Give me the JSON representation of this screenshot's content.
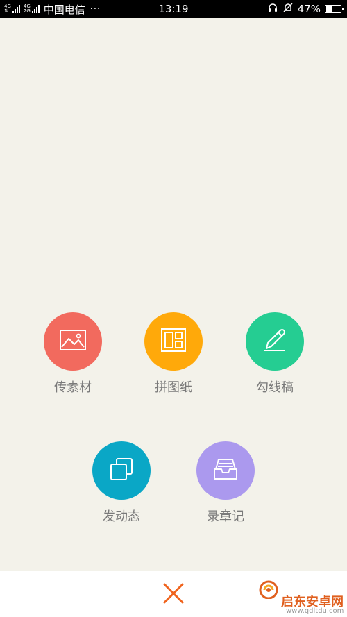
{
  "status_bar": {
    "network_1": "4G",
    "network_2": "4G",
    "network_2_sub": "2G",
    "carrier": "中国电信",
    "overflow": "···",
    "time": "13:19",
    "battery_text": "47%",
    "battery_level": 0.47,
    "icons": [
      "headset-icon",
      "alarm-off-icon",
      "battery-icon"
    ]
  },
  "actions": [
    {
      "label": "传素材",
      "color": "#f26a5e",
      "icon": "image-icon"
    },
    {
      "label": "拼图纸",
      "color": "#ffa90a",
      "icon": "layout-grid-icon"
    },
    {
      "label": "勾线稿",
      "color": "#25cd92",
      "icon": "pen-icon"
    },
    {
      "label": "发动态",
      "color": "#0aa7c6",
      "icon": "layers-icon"
    },
    {
      "label": "录章记",
      "color": "#ab99ee",
      "icon": "inbox-tray-icon"
    }
  ],
  "bottom_bar": {
    "close_icon": "close-icon",
    "close_color": "#f0641e"
  },
  "watermark": {
    "title": "启东安卓网",
    "url": "www.qdltdu.com",
    "color": "#e0601f"
  }
}
